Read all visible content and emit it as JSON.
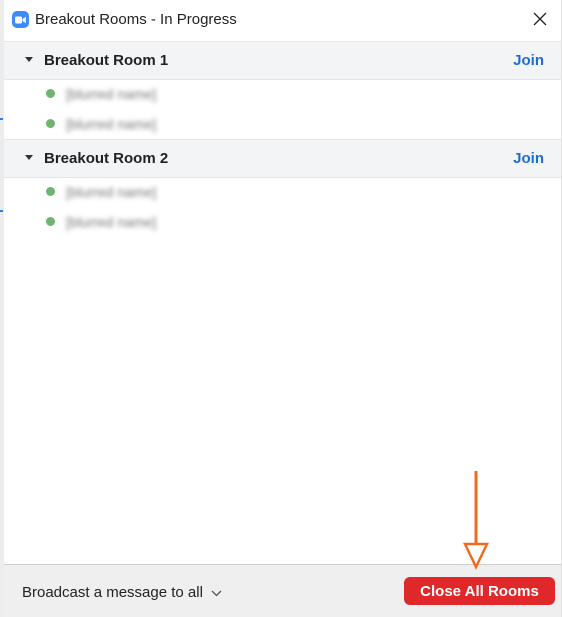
{
  "window": {
    "title": "Breakout Rooms - In Progress",
    "app_icon": "zoom-camera-icon",
    "close_icon": "close-icon"
  },
  "rooms": [
    {
      "name": "Breakout Room 1",
      "join_label": "Join",
      "expanded": true,
      "participants": [
        {
          "name": "[blurred name]",
          "status": "online"
        },
        {
          "name": "[blurred name]",
          "status": "online"
        }
      ]
    },
    {
      "name": "Breakout Room 2",
      "join_label": "Join",
      "expanded": true,
      "participants": [
        {
          "name": "[blurred name]",
          "status": "online"
        },
        {
          "name": "[blurred name]",
          "status": "online"
        }
      ]
    }
  ],
  "footer": {
    "broadcast_label": "Broadcast a message to all",
    "close_all_label": "Close All Rooms"
  },
  "annotation": {
    "type": "arrow",
    "points_to": "close-all-rooms-button",
    "color": "#f26a21"
  },
  "colors": {
    "join_link": "#1e6bd6",
    "close_all_button": "#e0282a",
    "status_dot": "#6fb36e",
    "room_header_bg": "#f3f4f6",
    "footer_bg": "#efefef"
  }
}
